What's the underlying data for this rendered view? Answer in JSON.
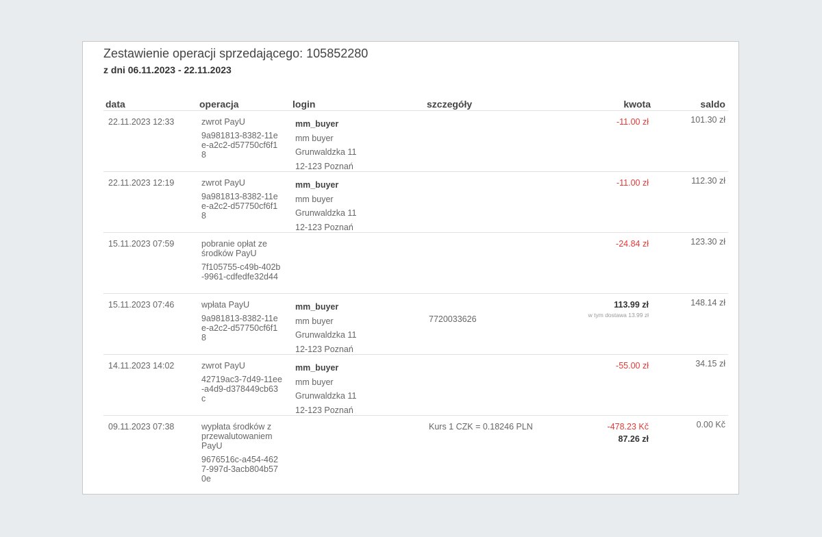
{
  "header": {
    "title": "Zestawienie operacji sprzedającego: 105852280",
    "period": "z dni 06.11.2023 - 22.11.2023"
  },
  "columns": {
    "date": "data",
    "operation": "operacja",
    "login": "login",
    "details": "szczegóły",
    "amount": "kwota",
    "balance": "saldo"
  },
  "rows": [
    {
      "date": "22.11.2023 12:33",
      "op_name": "zwrot PayU",
      "op_id": "9a981813-8382-11ee-a2c2-d57750cf6f18",
      "login_nick": "mm_buyer",
      "login_name": "mm buyer",
      "login_street": "Grunwaldzka 11",
      "login_city": "12-123 Poznań",
      "details": "",
      "amount": "-11.00 zł",
      "balance": "101.30 zł"
    },
    {
      "date": "22.11.2023 12:19",
      "op_name": "zwrot PayU",
      "op_id": "9a981813-8382-11ee-a2c2-d57750cf6f18",
      "login_nick": "mm_buyer",
      "login_name": "mm buyer",
      "login_street": "Grunwaldzka 11",
      "login_city": "12-123 Poznań",
      "details": "",
      "amount": "-11.00 zł",
      "balance": "112.30 zł"
    },
    {
      "date": "15.11.2023 07:59",
      "op_name": "pobranie opłat ze środków PayU",
      "op_id": "7f105755-c49b-402b-9961-cdfedfe32d44",
      "details": "",
      "amount": "-24.84 zł",
      "balance": "123.30 zł"
    },
    {
      "date": "15.11.2023 07:46",
      "op_name": "wpłata PayU",
      "op_id": "9a981813-8382-11ee-a2c2-d57750cf6f18",
      "login_nick": "mm_buyer",
      "login_name": "mm buyer",
      "login_street": "Grunwaldzka 11",
      "login_city": "12-123 Poznań",
      "details": "7720033626",
      "amount": "113.99 zł",
      "amount_note": "w tym dostawa 13.99 zł",
      "balance": "148.14 zł"
    },
    {
      "date": "14.11.2023 14:02",
      "op_name": "zwrot PayU",
      "op_id": "42719ac3-7d49-11ee-a4d9-d378449cb63c",
      "login_nick": "mm_buyer",
      "login_name": "mm buyer",
      "login_street": "Grunwaldzka 11",
      "login_city": "12-123 Poznań",
      "details": "",
      "amount": "-55.00 zł",
      "balance": "34.15 zł"
    },
    {
      "date": "09.11.2023 07:38",
      "op_name": "wypłata środków z przewalutowaniem PayU",
      "op_id": "9676516c-a454-4627-997d-3acb804b570e",
      "details": "Kurs 1 CZK = 0.18246 PLN",
      "amount": "-478.23 Kč",
      "amount_converted": "87.26 zł",
      "balance": "0.00 Kč"
    }
  ],
  "colors": {
    "negative": "#e53935",
    "background": "#e9ecef",
    "panel": "#ffffff"
  }
}
